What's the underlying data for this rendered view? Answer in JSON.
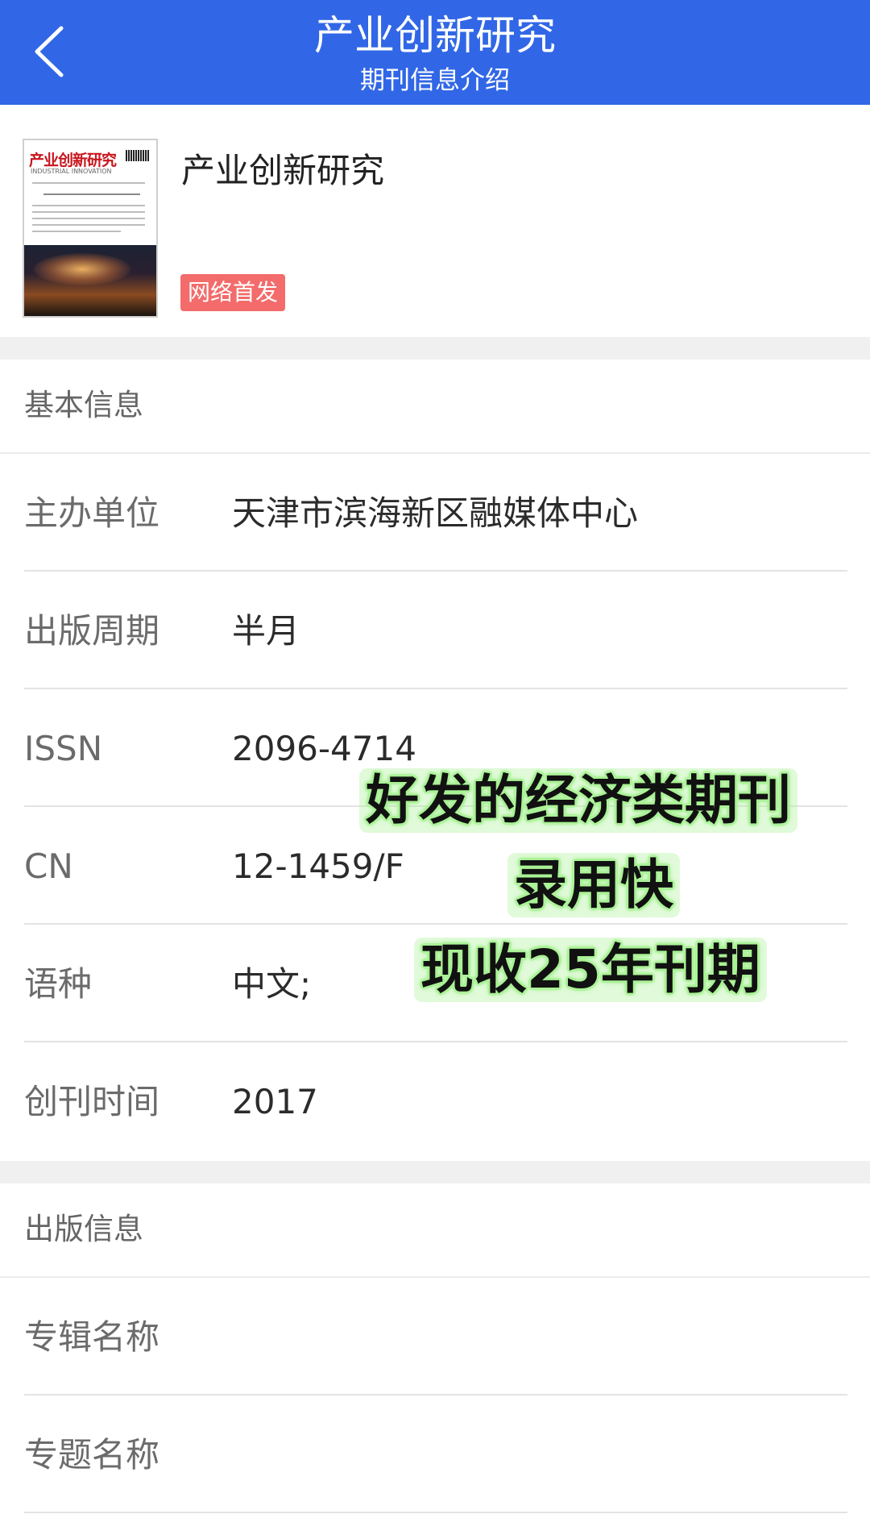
{
  "header": {
    "title": "产业创新研究",
    "subtitle": "期刊信息介绍"
  },
  "journal": {
    "name": "产业创新研究",
    "badge": "网络首发",
    "cover": {
      "masthead": "产业创新研究",
      "subtitle": "INDUSTRIAL INNOVATION"
    }
  },
  "basic_info": {
    "section_title": "基本信息",
    "rows": [
      {
        "label": "主办单位",
        "value": "天津市滨海新区融媒体中心"
      },
      {
        "label": "出版周期",
        "value": "半月"
      },
      {
        "label": "ISSN",
        "value": "2096-4714"
      },
      {
        "label": "CN",
        "value": "12-1459/F"
      },
      {
        "label": "语种",
        "value": "中文;"
      },
      {
        "label": "创刊时间",
        "value": "2017"
      }
    ]
  },
  "publication_info": {
    "section_title": "出版信息",
    "rows": [
      {
        "label": "专辑名称",
        "value": ""
      },
      {
        "label": "专题名称",
        "value": ""
      }
    ]
  },
  "overlay": {
    "line1": "好发的经济类期刊",
    "line2": "录用快",
    "line3": "现收25年刊期"
  },
  "colors": {
    "header_bg": "#3167e6",
    "badge_bg": "#f36b6b",
    "overlay_glow": "#aef39a"
  },
  "icons": {
    "back": "chevron-left-icon"
  }
}
